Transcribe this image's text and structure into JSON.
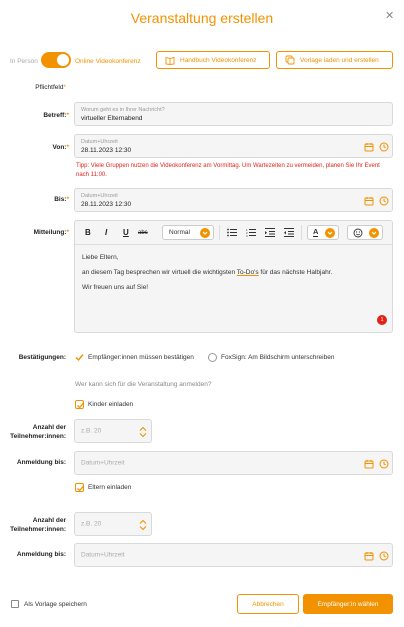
{
  "dialog": {
    "title": "Veranstaltung erstellen"
  },
  "mode": {
    "off_label": "In Person",
    "on_label": "Online Videokonferenz"
  },
  "toolbar": {
    "handbook_label": "Handbuch Videokonferenz",
    "template_label": "Vorlage laden und erstellen"
  },
  "form": {
    "required_note": "Pflichtfeld",
    "subject": {
      "label": "Betreff:",
      "placeholder": "Worum geht es in Ihrer Nachricht?",
      "value": "virtueller Elternabend"
    },
    "from": {
      "label": "Von:",
      "placeholder": "Datum+Uhrzeit",
      "value": "28.11.2023 12:30"
    },
    "hint": "Tipp: Viele Gruppen nutzen die Videokonferenz am Vormittag. Um Wartezeiten zu vermeiden, planen Sie Ihr Event nach 11:00.",
    "to": {
      "label": "Bis:",
      "placeholder": "Datum+Uhrzeit",
      "value": "28.11.2023 12:30"
    },
    "message": {
      "label": "Mitteilung:",
      "format_value": "Normal",
      "bold": "B",
      "italic": "I",
      "underline": "U",
      "strike": "abc",
      "font_color_glyph": "A",
      "line1": "Liebe Eltern,",
      "line2_a": "an diesem Tag besprechen wir virtuell die wichtigsten ",
      "line2_b": "To-Do's",
      "line2_c": " für das nächste Halbjahr.",
      "line3": "Wir freuen uns auf Sie!",
      "badge": "1"
    },
    "confirmations": {
      "label": "Bestätigungen:",
      "option1": "Empfänger:innen müssen bestätigen",
      "option2": "FoxSign: Am Bildschirm unterschreiben"
    },
    "signup_question": "Wer kann sich für die Veranstaltung anmelden?",
    "children": {
      "invite_label": "Kinder einladen",
      "count_label_1": "Anzahl der",
      "count_label_2": "Teilnehmer:innen:",
      "count_placeholder": "z.B. 20",
      "signup_label": "Anmeldung bis:",
      "signup_placeholder": "Datum+Uhrzeit"
    },
    "parents": {
      "invite_label": "Eltern einladen",
      "count_label_1": "Anzahl der",
      "count_label_2": "Teilnehmer:innen:",
      "count_placeholder": "z.B. 20",
      "signup_label": "Anmeldung bis:",
      "signup_placeholder": "Datum+Uhrzeit"
    }
  },
  "footer": {
    "save_template": "Als Vorlage speichern",
    "cancel": "Abbrechen",
    "choose_recipients": "Empfänger:in wählen"
  },
  "colors": {
    "accent": "#f39200",
    "hint": "#e2231a",
    "field_bg": "#f5f5f5"
  }
}
